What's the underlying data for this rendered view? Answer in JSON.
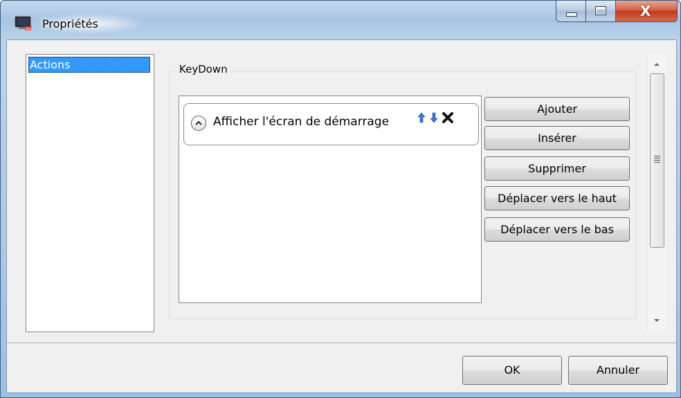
{
  "window": {
    "title": "Propriétés",
    "icon": "app-monitor-icon",
    "controls": [
      "minimize-icon",
      "maximize-icon",
      "close-icon"
    ],
    "close_glyph": "X"
  },
  "sidebar": {
    "items": [
      {
        "label": "Actions",
        "selected": true
      }
    ]
  },
  "event_group": {
    "label": "KeyDown",
    "actions": [
      {
        "label": "Afficher l'écran de démarrage",
        "icons": [
          "expand-up-icon",
          "move-up-arrow-icon",
          "move-down-arrow-icon",
          "delete-x-icon"
        ]
      }
    ]
  },
  "buttons": {
    "add": "Ajouter",
    "insert": "Insérer",
    "delete": "Supprimer",
    "move_up": "Déplacer vers le haut",
    "move_down": "Déplacer vers le bas"
  },
  "footer": {
    "ok": "OK",
    "cancel": "Annuler"
  },
  "colors": {
    "selection": "#3399ff",
    "arrow_blue": "#3c78d8",
    "close_red": "#c0391c"
  }
}
